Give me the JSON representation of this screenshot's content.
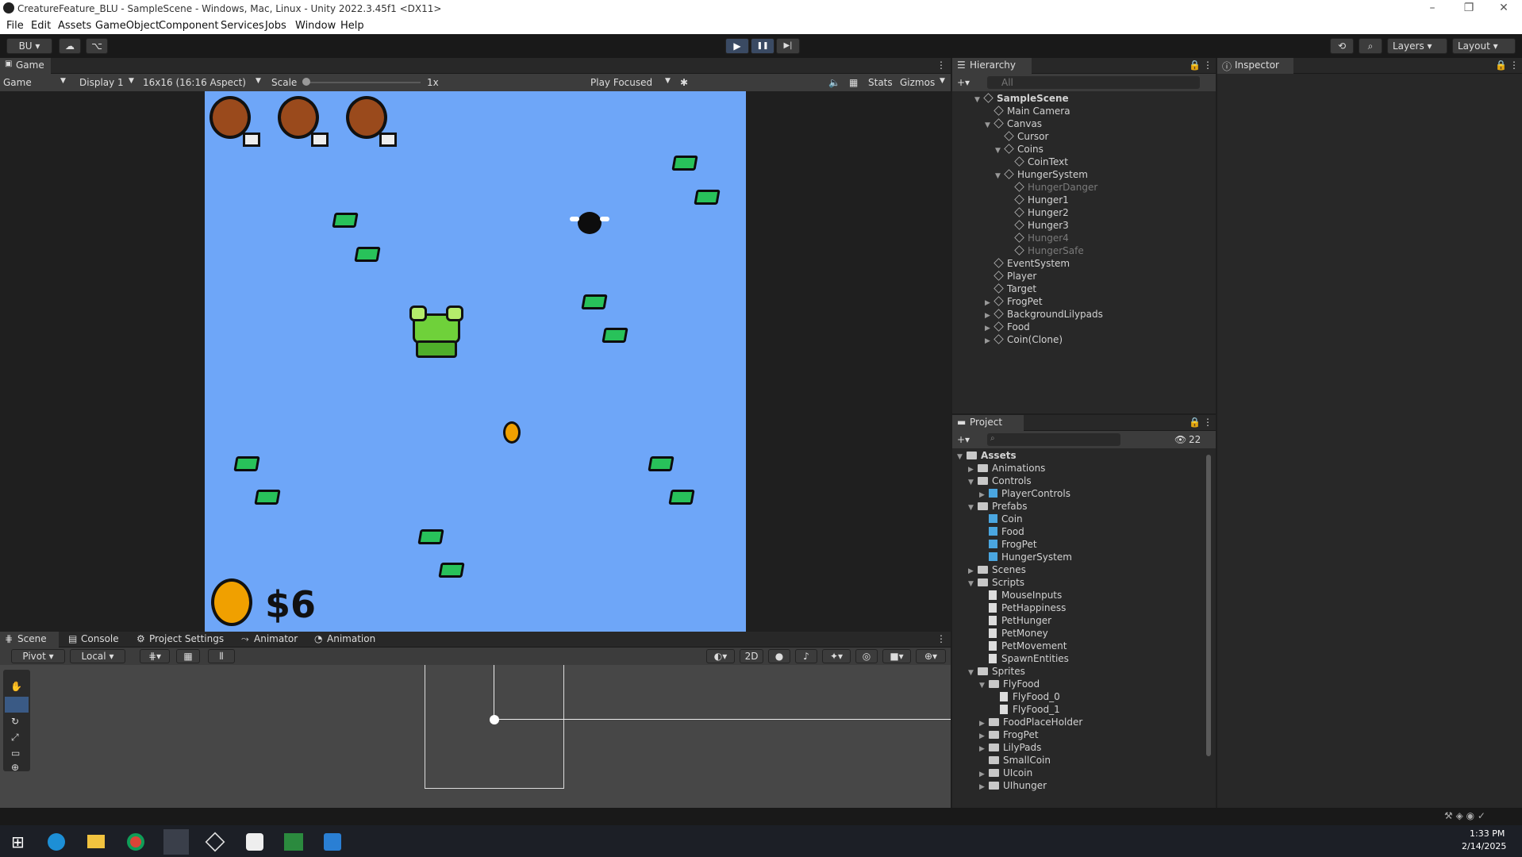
{
  "window": {
    "title": "CreatureFeature_BLU - SampleScene - Windows, Mac, Linux - Unity 2022.3.45f1 <DX11>",
    "min": "–",
    "max": "❐",
    "close": "✕"
  },
  "menu": [
    "File",
    "Edit",
    "Assets",
    "GameObject",
    "Component",
    "Services",
    "Jobs",
    "Window",
    "Help"
  ],
  "toolbar": {
    "account": "BU",
    "play": "▶",
    "pause": "❚❚",
    "step": "▶|",
    "layers": "Layers",
    "layout": "Layout"
  },
  "game": {
    "tab": "Game",
    "mode": "Game",
    "display": "Display 1",
    "aspect": "16x16 (16:16 Aspect)",
    "scale_label": "Scale",
    "scale_value": "1x",
    "play_mode": "Play Focused",
    "stats": "Stats",
    "gizmos": "Gizmos",
    "coin_text": "$6"
  },
  "hierarchy": {
    "tab": "Hierarchy",
    "search": "All",
    "items": [
      {
        "label": "SampleScene",
        "level": 0,
        "arrow": "▼",
        "dim": false
      },
      {
        "label": "Main Camera",
        "level": 1,
        "arrow": "",
        "dim": false
      },
      {
        "label": "Canvas",
        "level": 1,
        "arrow": "▼",
        "dim": false
      },
      {
        "label": "Cursor",
        "level": 2,
        "arrow": "",
        "dim": false
      },
      {
        "label": "Coins",
        "level": 2,
        "arrow": "▼",
        "dim": false
      },
      {
        "label": "CoinText",
        "level": 3,
        "arrow": "",
        "dim": false
      },
      {
        "label": "HungerSystem",
        "level": 2,
        "arrow": "▼",
        "dim": false
      },
      {
        "label": "HungerDanger",
        "level": 3,
        "arrow": "",
        "dim": true
      },
      {
        "label": "Hunger1",
        "level": 3,
        "arrow": "",
        "dim": false
      },
      {
        "label": "Hunger2",
        "level": 3,
        "arrow": "",
        "dim": false
      },
      {
        "label": "Hunger3",
        "level": 3,
        "arrow": "",
        "dim": false
      },
      {
        "label": "Hunger4",
        "level": 3,
        "arrow": "",
        "dim": true
      },
      {
        "label": "HungerSafe",
        "level": 3,
        "arrow": "",
        "dim": true
      },
      {
        "label": "EventSystem",
        "level": 1,
        "arrow": "",
        "dim": false
      },
      {
        "label": "Player",
        "level": 1,
        "arrow": "",
        "dim": false
      },
      {
        "label": "Target",
        "level": 1,
        "arrow": "",
        "dim": false
      },
      {
        "label": "FrogPet",
        "level": 1,
        "arrow": "▶",
        "dim": false
      },
      {
        "label": "BackgroundLilypads",
        "level": 1,
        "arrow": "▶",
        "dim": false
      },
      {
        "label": "Food",
        "level": 1,
        "arrow": "▶",
        "dim": false
      },
      {
        "label": "Coin(Clone)",
        "level": 1,
        "arrow": "▶",
        "dim": false
      }
    ]
  },
  "inspector": {
    "tab": "Inspector"
  },
  "project": {
    "tab": "Project",
    "count": "22",
    "items": [
      {
        "label": "Assets",
        "level": 0,
        "arrow": "▼",
        "kind": "folder"
      },
      {
        "label": "Animations",
        "level": 1,
        "arrow": "▶",
        "kind": "folder"
      },
      {
        "label": "Controls",
        "level": 1,
        "arrow": "▼",
        "kind": "folder"
      },
      {
        "label": "PlayerControls",
        "level": 2,
        "arrow": "▶",
        "kind": "asset"
      },
      {
        "label": "Prefabs",
        "level": 1,
        "arrow": "▼",
        "kind": "folder"
      },
      {
        "label": "Coin",
        "level": 2,
        "arrow": "",
        "kind": "prefab"
      },
      {
        "label": "Food",
        "level": 2,
        "arrow": "",
        "kind": "prefab"
      },
      {
        "label": "FrogPet",
        "level": 2,
        "arrow": "",
        "kind": "prefab"
      },
      {
        "label": "HungerSystem",
        "level": 2,
        "arrow": "",
        "kind": "prefab"
      },
      {
        "label": "Scenes",
        "level": 1,
        "arrow": "▶",
        "kind": "folder"
      },
      {
        "label": "Scripts",
        "level": 1,
        "arrow": "▼",
        "kind": "folder"
      },
      {
        "label": "MouseInputs",
        "level": 2,
        "arrow": "",
        "kind": "script"
      },
      {
        "label": "PetHappiness",
        "level": 2,
        "arrow": "",
        "kind": "script"
      },
      {
        "label": "PetHunger",
        "level": 2,
        "arrow": "",
        "kind": "script"
      },
      {
        "label": "PetMoney",
        "level": 2,
        "arrow": "",
        "kind": "script"
      },
      {
        "label": "PetMovement",
        "level": 2,
        "arrow": "",
        "kind": "script"
      },
      {
        "label": "SpawnEntities",
        "level": 2,
        "arrow": "",
        "kind": "script"
      },
      {
        "label": "Sprites",
        "level": 1,
        "arrow": "▼",
        "kind": "folder"
      },
      {
        "label": "FlyFood",
        "level": 2,
        "arrow": "▼",
        "kind": "sprite"
      },
      {
        "label": "FlyFood_0",
        "level": 3,
        "arrow": "",
        "kind": "sub"
      },
      {
        "label": "FlyFood_1",
        "level": 3,
        "arrow": "",
        "kind": "sub"
      },
      {
        "label": "FoodPlaceHolder",
        "level": 2,
        "arrow": "▶",
        "kind": "sprite"
      },
      {
        "label": "FrogPet",
        "level": 2,
        "arrow": "▶",
        "kind": "sprite"
      },
      {
        "label": "LilyPads",
        "level": 2,
        "arrow": "▶",
        "kind": "sprite"
      },
      {
        "label": "SmallCoin",
        "level": 2,
        "arrow": "",
        "kind": "sprite"
      },
      {
        "label": "UIcoin",
        "level": 2,
        "arrow": "▶",
        "kind": "sprite"
      },
      {
        "label": "UIhunger",
        "level": 2,
        "arrow": "▶",
        "kind": "sprite"
      }
    ]
  },
  "bottom_tabs": [
    "Scene",
    "Console",
    "Project Settings",
    "Animator",
    "Animation"
  ],
  "scene_toolbar": {
    "pivot": "Pivot",
    "local": "Local",
    "mode2d": "2D"
  },
  "taskbar": {
    "time": "1:33 PM",
    "date": "2/14/2025"
  },
  "colors": {
    "game_bg": "#6ea6f8",
    "leaf": "#28c25a",
    "frog": "#6fd13a",
    "coin": "#f0a000"
  }
}
